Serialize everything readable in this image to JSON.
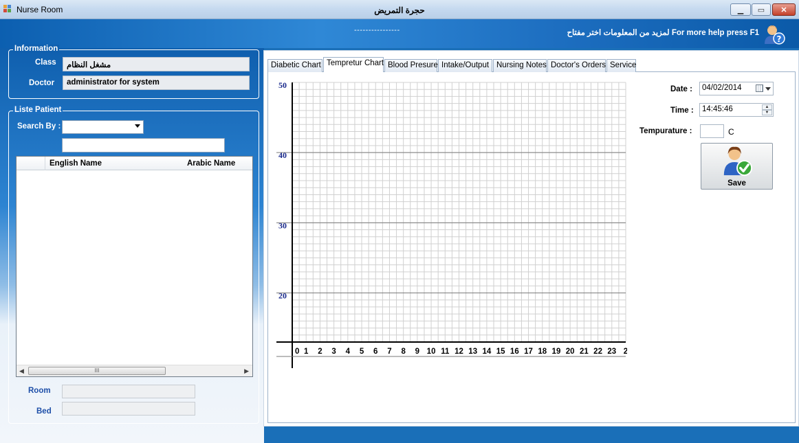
{
  "window": {
    "title": "Nurse Room",
    "title_center": "حجرة التمريض",
    "minimize": "▁",
    "maximize": "▭",
    "close": "✕"
  },
  "header": {
    "dashes": "----------------",
    "help_text": "لمزيد من المعلومات اختر مفتاح   For more help press F1",
    "help_icon": "help-user-icon"
  },
  "information": {
    "group_title": "Information",
    "class_label": "Class",
    "class_value": "مشغل النظام",
    "doctor_label": "Doctor",
    "doctor_value": "administrator for system"
  },
  "patients": {
    "group_title": "Liste Patient",
    "search_by_label": "Search By :",
    "search_by_value": "",
    "search_text": "",
    "columns": [
      "English Name",
      "Arabic Name"
    ],
    "rows": [],
    "scroll_thumb": "III",
    "room_label": "Room",
    "room_value": "",
    "bed_label": "Bed",
    "bed_value": ""
  },
  "tabs": [
    {
      "label": "Diabetic Chart",
      "active": false
    },
    {
      "label": "Tempretur Chart",
      "active": true
    },
    {
      "label": "Blood Presure",
      "active": false
    },
    {
      "label": "Intake/Output",
      "active": false
    },
    {
      "label": "Nursing Notes",
      "active": false
    },
    {
      "label": "Doctor's Orders",
      "active": false
    },
    {
      "label": "Service",
      "active": false
    }
  ],
  "form": {
    "date_label": "Date :",
    "date_value": "04/02/2014",
    "time_label": "Time :",
    "time_value": "14:45:46",
    "temp_label": "Tempurature :",
    "temp_value": "",
    "temp_unit": "C",
    "save_label": "Save",
    "save_icon": "user-check-icon"
  },
  "chart_data": {
    "type": "line",
    "title": "",
    "xlabel": "",
    "ylabel": "",
    "x_ticks": [
      "0",
      "1",
      "2",
      "3",
      "4",
      "5",
      "6",
      "7",
      "8",
      "9",
      "10",
      "11",
      "12",
      "13",
      "14",
      "15",
      "16",
      "17",
      "18",
      "19",
      "20",
      "21",
      "22",
      "23",
      "2"
    ],
    "y_ticks": [
      50,
      40,
      30,
      20
    ],
    "ylim": [
      13,
      50
    ],
    "xlim": [
      0,
      24
    ],
    "grid": true,
    "series": [],
    "colors": {
      "axis_label": "#1a2a8c",
      "grid_minor": "#d0d0d0",
      "grid_major": "#7a7a7a"
    }
  }
}
